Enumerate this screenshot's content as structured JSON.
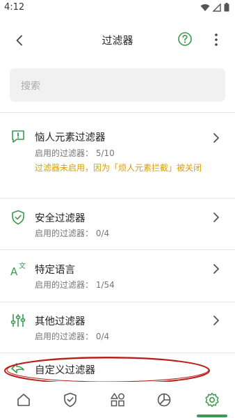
{
  "status_bar": {
    "time": "4:12"
  },
  "header": {
    "title": "过滤器"
  },
  "search": {
    "placeholder": "搜索"
  },
  "filters": [
    {
      "name": "恼人元素过滤器",
      "count": "启用的过滤器： 5/10",
      "warning": "过滤器未启用，因为「烦人元素拦截」被关闭",
      "icon": "comment-alert-icon"
    },
    {
      "name": "安全过滤器",
      "count": "启用的过滤器： 0/4",
      "icon": "shield-check-icon"
    },
    {
      "name": "特定语言",
      "count": "启用的过滤器： 1/54",
      "icon": "translate-icon"
    },
    {
      "name": "其他过滤器",
      "count": "启用的过滤器： 0/4",
      "icon": "sliders-icon"
    },
    {
      "name": "自定义过滤器",
      "icon": "custom-filter-icon"
    }
  ],
  "bottom_nav": [
    "home-icon",
    "protection-icon",
    "apps-icon",
    "stats-icon",
    "settings-icon"
  ],
  "colors": {
    "accent": "#3b9a4f",
    "warning": "#d8a000",
    "annotation": "#b8201a"
  }
}
